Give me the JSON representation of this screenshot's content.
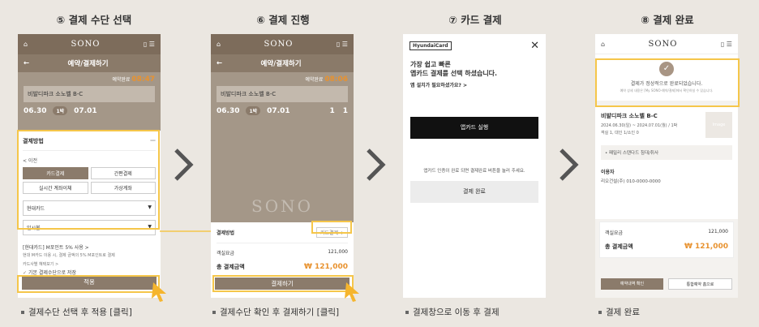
{
  "steps": [
    {
      "title": "⑤ 결제 수단 선택",
      "caption": "결제수단 선택 후 적용 [클릭]"
    },
    {
      "title": "⑥ 결제 진행",
      "caption": "결제수단 확인 후 결제하기 [클릭]"
    },
    {
      "title": "⑦ 카드 결제",
      "caption": "결제창으로 이동 후 결제"
    },
    {
      "title": "⑧ 결제 완료",
      "caption": "결제 완료"
    }
  ],
  "app": {
    "logo": "SONO",
    "page_title": "예약/결제하기"
  },
  "booking": {
    "timer_label": "예약완료",
    "timer_value": "08:47",
    "timer_value2": "08:06",
    "room_name": "비발디파크 소노벨 B-C",
    "checkin_date": "06.30",
    "checkin_day": "일요일",
    "nights": "1박",
    "checkout_date": "07.01",
    "checkout_day": "월요일",
    "rooms_label": "객실",
    "people_label": "인원",
    "rooms": "1",
    "people": "1",
    "watermark": "SONO"
  },
  "payment_sheet": {
    "title": "결제방법",
    "close": "—",
    "back": "< 이전",
    "methods": [
      "카드결제",
      "간편결제",
      "실시간 계좌이체",
      "가상계좌"
    ],
    "card_select": "현대카드",
    "installment_select": "일시불",
    "promo": "[현대카드] M포인트 5% 사용 >",
    "promo_desc": "현대 M카드 이용 시, 결제 금액의 5% M포인트로 결제",
    "card_link": "카드사별 혜택보기 >",
    "save_default": "기본 결제수단으로 저장",
    "apply": "적용"
  },
  "step6": {
    "method_label": "결제방법",
    "method_value": "카드결제",
    "room_fee_label": "객실요금",
    "room_fee": "121,000",
    "total_label": "총 결제금액",
    "total": "₩ 121,000",
    "pay_button": "결제하기"
  },
  "step7": {
    "brand": "HyundaiCard",
    "close": "✕",
    "heading1": "가장 쉽고 빠른",
    "heading2": "앱카드 결제를 선택 하셨습니다.",
    "install_q": "앱 설치가 필요하셨가요? >",
    "run_button": "앱카드 실행",
    "notice": "앱카드 인증이 완료 되면 결제완료 버튼을 눌러 주세요.",
    "done_button": "결제 완료"
  },
  "step8": {
    "complete_msg": "결제가 정상적으로 완료되었습니다.",
    "complete_sub": "예약 상세 내용은 [My SONO-예약/결제]에서 확인하실 수 있습니다.",
    "room_name": "비발디파크 소노벨 B-C",
    "dates": "2024.06.30(일) ~ 2024.07.01(월) / 1박",
    "guests": "객실 1, 대인 1/소인 0",
    "room_type": "• 패밀리 스탠다드  침대/취사",
    "user_label": "이용자",
    "user_value": "리오건설(주)  010-0000-0000",
    "room_fee_label": "객실요금",
    "room_fee": "121,000",
    "total_label": "총 결제금액",
    "total": "₩ 121,000",
    "btn_confirm": "예약내역 확인",
    "btn_more": "통합예약 홈으로",
    "thumb": "Image"
  }
}
